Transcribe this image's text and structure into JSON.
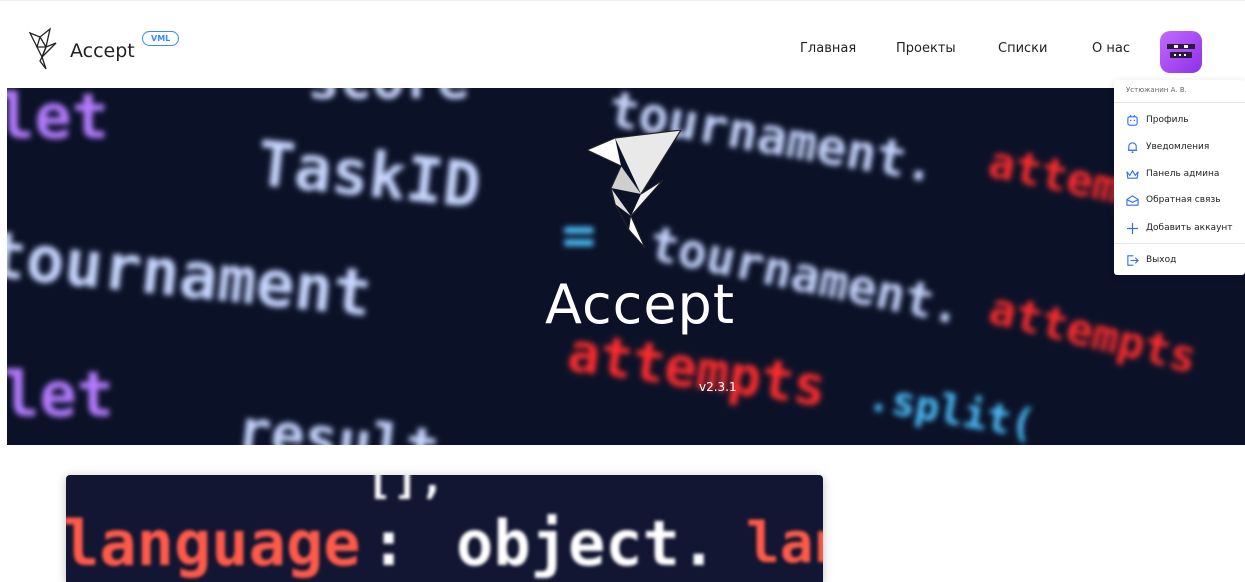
{
  "header": {
    "brand": "Accept",
    "badge": "VML",
    "nav": [
      "Главная",
      "Проекты",
      "Списки",
      "О нас"
    ],
    "avatar_colors": [
      "#c26bff",
      "#8e2fe8"
    ]
  },
  "hero": {
    "title": "Accept",
    "version": "v2.3.1",
    "code_lines": [
      {
        "text": "let",
        "color": "#b47cff"
      },
      {
        "text": "TaskID",
        "color": "#c9d7ff"
      },
      {
        "text": "=",
        "color": "#4dc3ff"
      },
      {
        "text": "tournament.",
        "color": "#c9d7ff"
      },
      {
        "text": "attempts",
        "color": "#ff2d2d"
      },
      {
        "text": "tournament",
        "color": "#c9d7ff"
      },
      {
        "text": "let",
        "color": "#b47cff"
      },
      {
        "text": "result",
        "color": "#c9d7ff"
      },
      {
        "text": ".split(",
        "color": "#4dc3ff"
      },
      {
        "text": "score",
        "color": "#c9d7ff"
      }
    ]
  },
  "dropdown": {
    "user": "Устюжанин А. В.",
    "items": [
      {
        "label": "Профиль",
        "icon": "profile-icon"
      },
      {
        "label": "Уведомления",
        "icon": "bell-icon"
      },
      {
        "label": "Панель админа",
        "icon": "crown-icon"
      },
      {
        "label": "Обратная связь",
        "icon": "mail-icon"
      },
      {
        "label": "Добавить аккаунт",
        "icon": "plus-icon"
      },
      {
        "label": "Выход",
        "icon": "logout-icon"
      }
    ],
    "accent": "#2e6ff2"
  },
  "card": {
    "line1": "[],",
    "line2_key": "language",
    "line2_sep": ":",
    "line2_obj": "object.",
    "line2_tail": "lang"
  }
}
